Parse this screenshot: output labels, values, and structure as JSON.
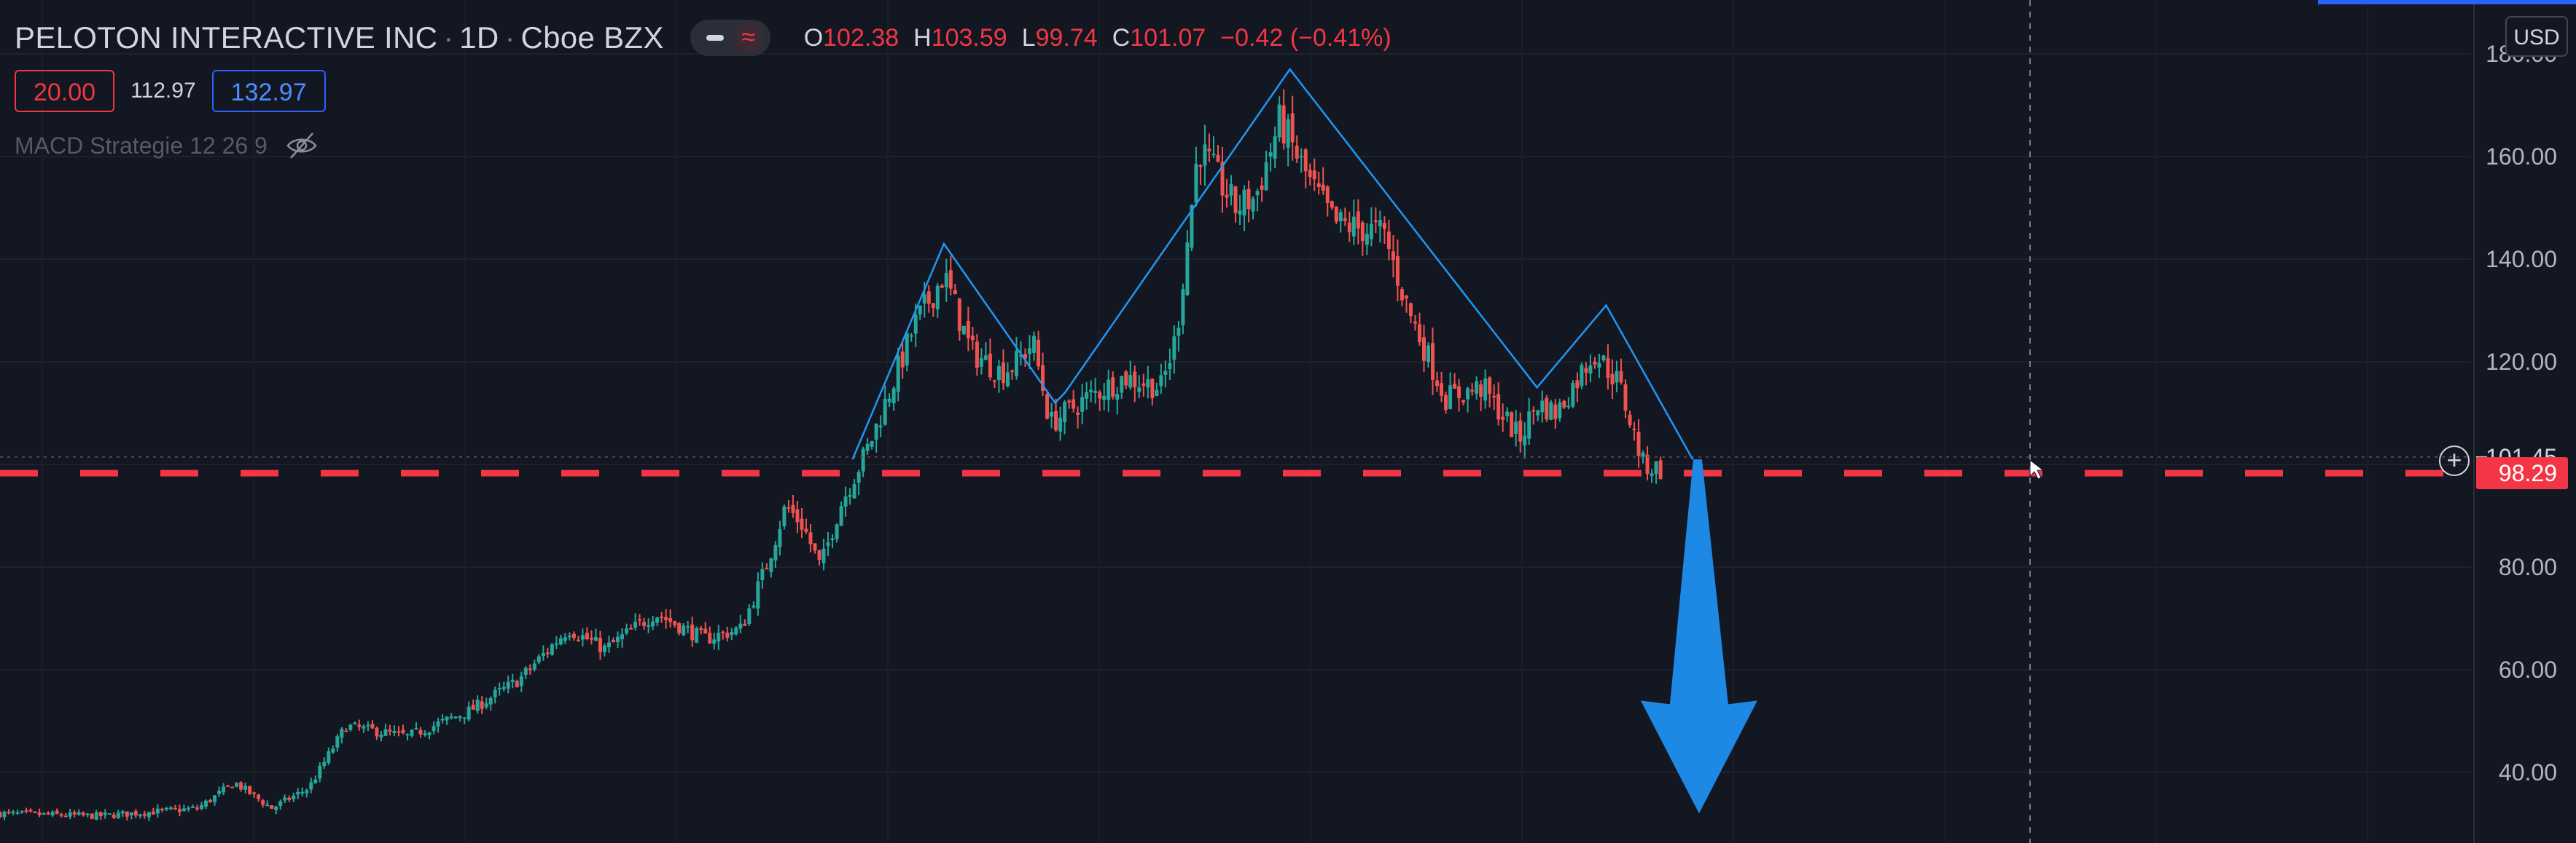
{
  "header": {
    "symbol": "PELOTON INTERACTIVE INC",
    "interval": "1D",
    "exchange": "Cboe BZX",
    "ohlc": {
      "o_label": "O",
      "o": "102.38",
      "h_label": "H",
      "h": "103.59",
      "l_label": "L",
      "l": "99.74",
      "c_label": "C",
      "c": "101.07",
      "change": "−0.42 (−0.41%)"
    }
  },
  "toolbar": {
    "left_value": "20.00",
    "mid_value": "112.97",
    "right_value": "132.97"
  },
  "indicator": {
    "name": "MACD Strategie 12 26 9"
  },
  "currency": "USD",
  "colors": {
    "background": "#131722",
    "up": "#26a69a",
    "down": "#ef5350",
    "pattern_line": "#2196f3",
    "arrow": "#1e88e5",
    "support": "#f23645"
  },
  "chart_data": {
    "type": "candlestick",
    "y_axis_ticks": [
      "40.00",
      "60.00",
      "80.00",
      "100.00",
      "120.00",
      "140.00",
      "160.00",
      "180.00"
    ],
    "ylim": [
      32,
      182
    ],
    "price_labels": [
      {
        "value": 101.45,
        "label": "101.45",
        "style": "current"
      },
      {
        "value": 98.29,
        "label": "98.29",
        "style": "support"
      }
    ],
    "support_level": 98.29,
    "pattern": {
      "name": "head and shoulders",
      "polyline": [
        [
          0.345,
          101
        ],
        [
          0.382,
          143
        ],
        [
          0.427,
          112
        ],
        [
          0.431,
          114
        ],
        [
          0.522,
          177
        ],
        [
          0.622,
          115
        ],
        [
          0.65,
          131
        ],
        [
          0.685,
          101
        ]
      ]
    },
    "arrow": {
      "from": 101,
      "to": 32,
      "x": 0.687,
      "direction": "down"
    },
    "candle_count": 380,
    "closes": [
      [
        0.0,
        32
      ],
      [
        0.04,
        31.5
      ],
      [
        0.08,
        33
      ],
      [
        0.095,
        38
      ],
      [
        0.11,
        33
      ],
      [
        0.125,
        37
      ],
      [
        0.14,
        49
      ],
      [
        0.165,
        47
      ],
      [
        0.19,
        52
      ],
      [
        0.21,
        58
      ],
      [
        0.23,
        68
      ],
      [
        0.245,
        64
      ],
      [
        0.265,
        71
      ],
      [
        0.285,
        66
      ],
      [
        0.3,
        68
      ],
      [
        0.31,
        80
      ],
      [
        0.318,
        92
      ],
      [
        0.325,
        88
      ],
      [
        0.332,
        80
      ],
      [
        0.34,
        92
      ],
      [
        0.352,
        104
      ],
      [
        0.37,
        127
      ],
      [
        0.382,
        137
      ],
      [
        0.393,
        122
      ],
      [
        0.405,
        118
      ],
      [
        0.412,
        120
      ],
      [
        0.418,
        124
      ],
      [
        0.425,
        108
      ],
      [
        0.44,
        113
      ],
      [
        0.455,
        117
      ],
      [
        0.47,
        115
      ],
      [
        0.476,
        125
      ],
      [
        0.485,
        162
      ],
      [
        0.5,
        150
      ],
      [
        0.508,
        152
      ],
      [
        0.518,
        167
      ],
      [
        0.53,
        155
      ],
      [
        0.54,
        147
      ],
      [
        0.56,
        145
      ],
      [
        0.57,
        130
      ],
      [
        0.585,
        113
      ],
      [
        0.6,
        115
      ],
      [
        0.615,
        105
      ],
      [
        0.622,
        112
      ],
      [
        0.63,
        110
      ],
      [
        0.645,
        122
      ],
      [
        0.655,
        116
      ],
      [
        0.665,
        100
      ],
      [
        0.672,
        99
      ]
    ]
  }
}
